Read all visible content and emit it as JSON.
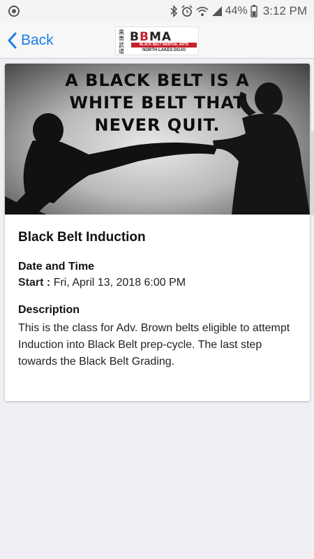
{
  "status_bar": {
    "battery": "44%",
    "time": "3:12 PM"
  },
  "nav": {
    "back_label": "Back",
    "logo": {
      "kanji": "黒帯武道",
      "name_prefix": "B",
      "name_accent": "B",
      "name_rest": "MA",
      "tagline": "BLACK BELT MARTIAL ARTS",
      "dojo": "NORTH LAKES DOJO"
    }
  },
  "hero": {
    "quote_line1": "A BLACK BELT IS A",
    "quote_line2": "WHITE BELT THAT",
    "quote_line3": "NEVER QUIT."
  },
  "event": {
    "title": "Black Belt Induction",
    "date_heading": "Date and Time",
    "start_label": "Start :",
    "start_value": "Fri, April 13, 2018 6:00 PM",
    "description_heading": "Description",
    "description": "This is the class for Adv. Brown belts eligible to attempt Induction into Black Belt prep-cycle. The last step towards the Black Belt Grading."
  }
}
